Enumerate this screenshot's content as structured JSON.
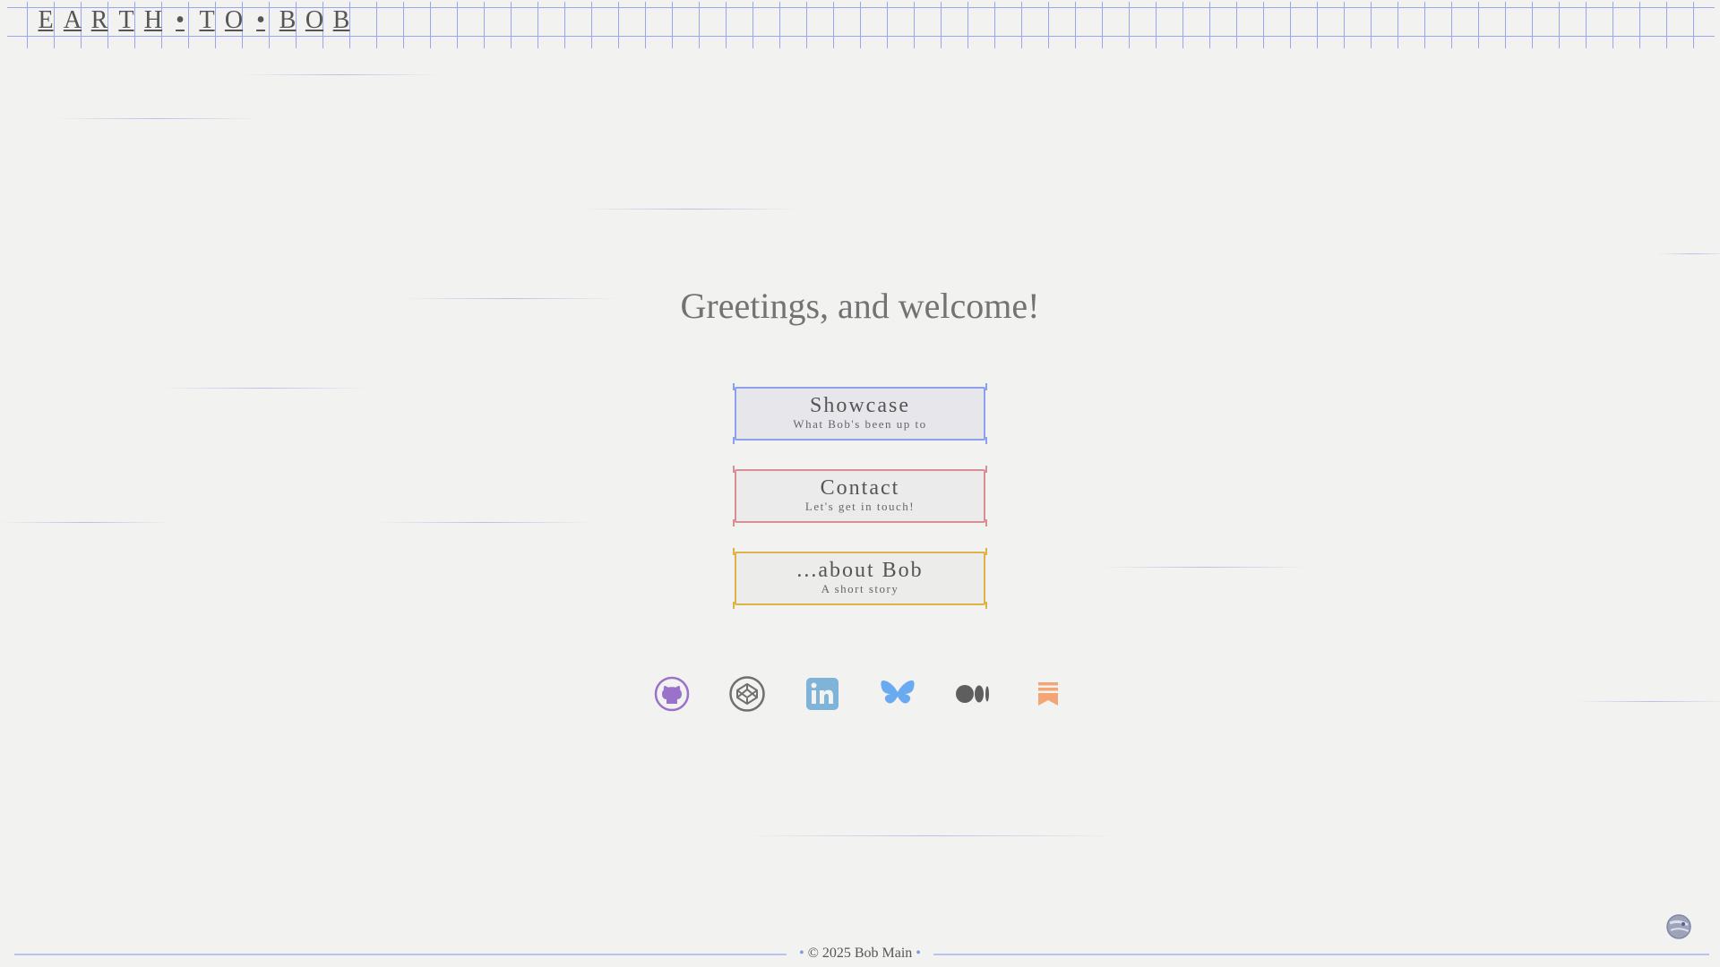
{
  "header": {
    "logo_letters": [
      "E",
      "A",
      "R",
      "T",
      "H",
      "•",
      "T",
      "O",
      "•",
      "B",
      "O",
      "B"
    ]
  },
  "main": {
    "greeting": "Greetings, and welcome!",
    "nav": [
      {
        "title": "Showcase",
        "subtitle": "What Bob's been up to",
        "color": "#8da0ef"
      },
      {
        "title": "Contact",
        "subtitle": "Let's get in touch!",
        "color": "#d88e92"
      },
      {
        "title": "...about Bob",
        "subtitle": "A short story",
        "color": "#ddb24a"
      }
    ],
    "socials": [
      {
        "icon": "github-icon",
        "color": "#9b72c9"
      },
      {
        "icon": "codepen-icon",
        "color": "#6f6f6f"
      },
      {
        "icon": "linkedin-icon",
        "color": "#7fb3d8"
      },
      {
        "icon": "bluesky-icon",
        "color": "#6aaaf0"
      },
      {
        "icon": "medium-icon",
        "color": "#5e5e5e"
      },
      {
        "icon": "substack-icon",
        "color": "#f2a676"
      }
    ]
  },
  "footer": {
    "copyright": "© 2025 Bob Main",
    "bullet": "•"
  },
  "colors": {
    "background": "#f2f2f1",
    "grid": "#9aa7ee",
    "text": "#555555"
  }
}
